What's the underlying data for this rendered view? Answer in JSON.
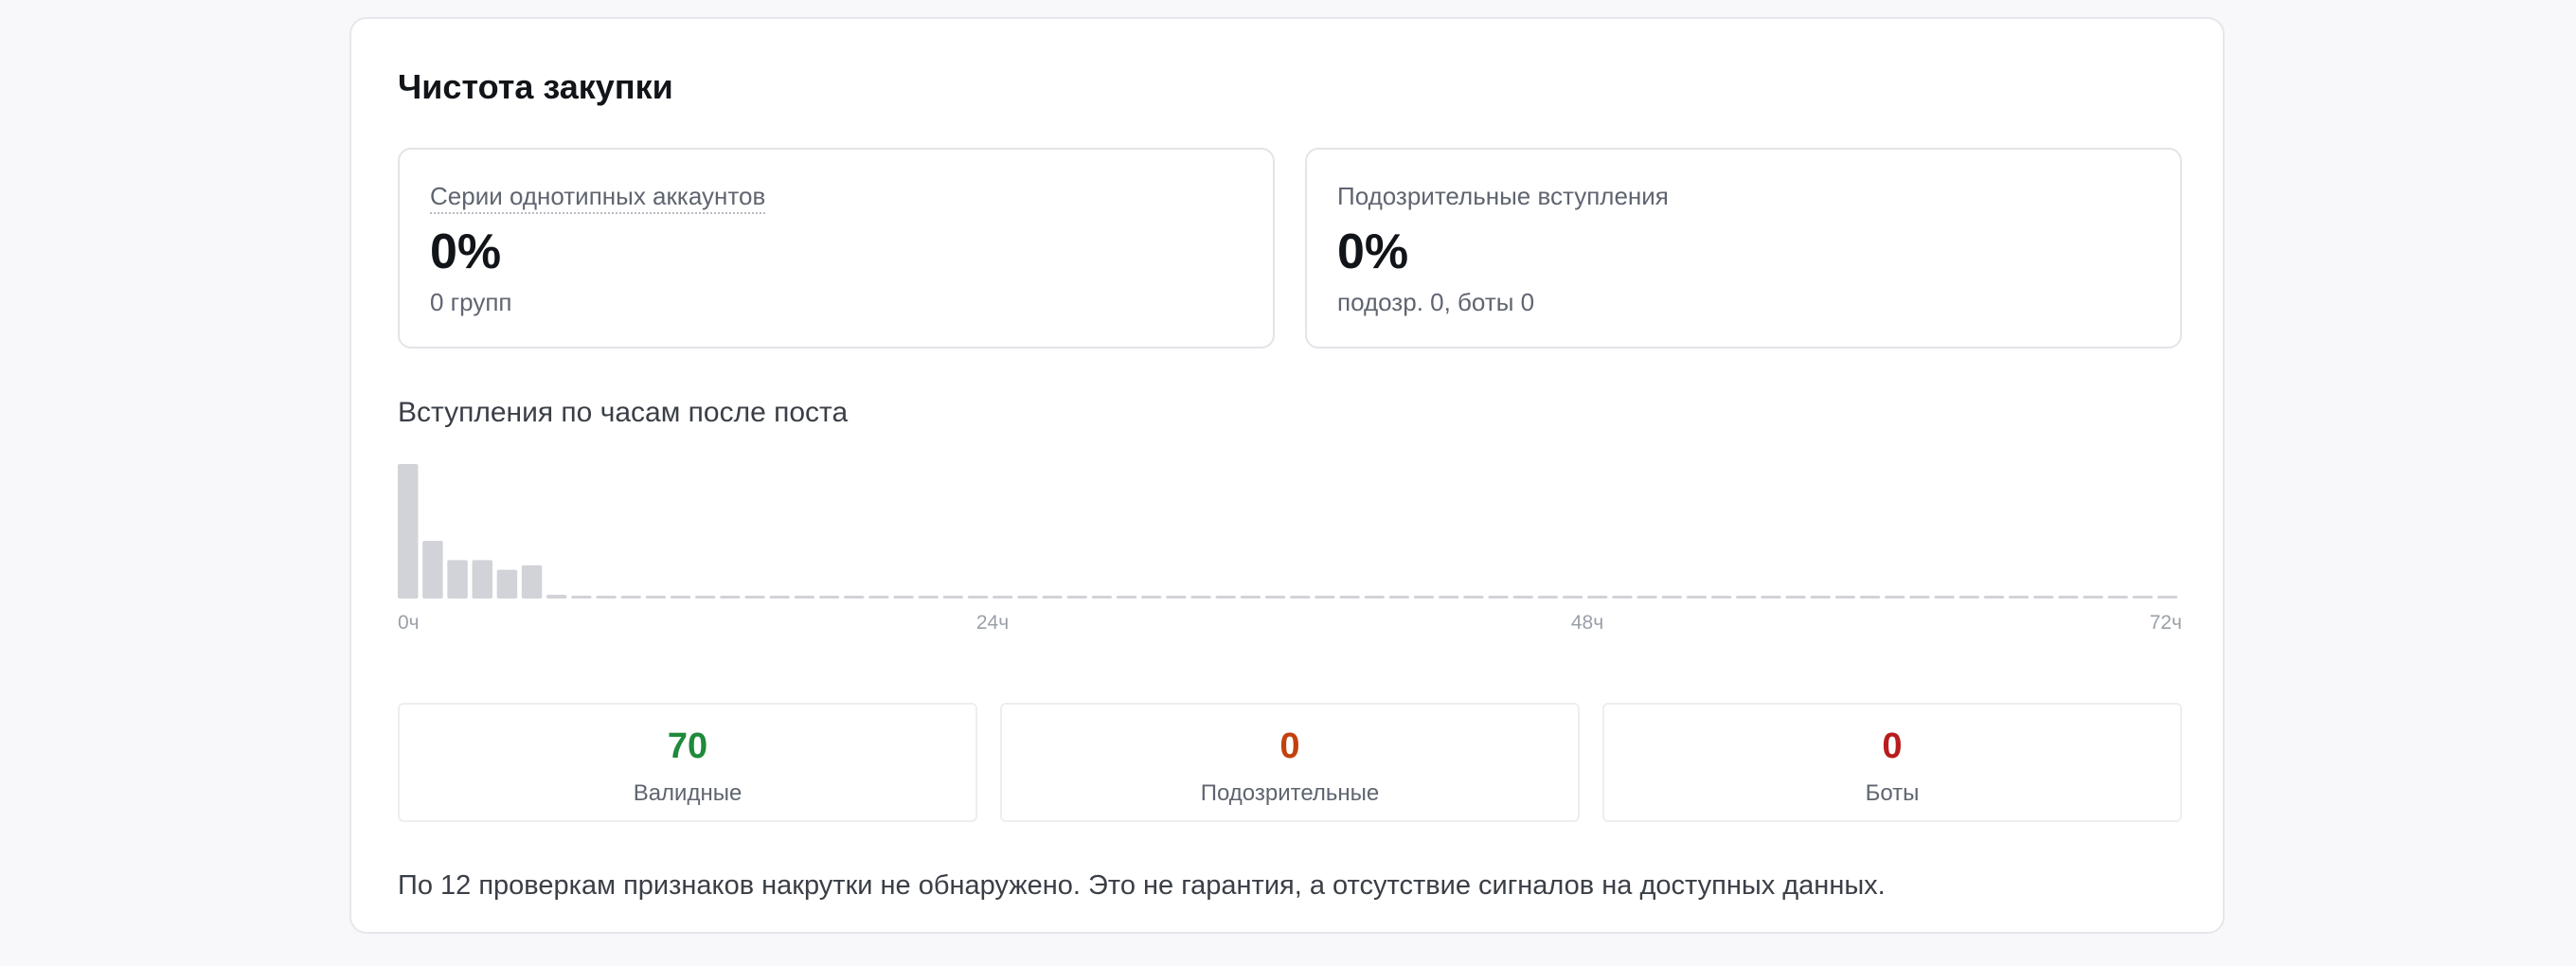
{
  "section": {
    "title": "Чистота закупки"
  },
  "metrics": [
    {
      "label": "Серии однотипных аккаунтов",
      "value": "0%",
      "sub": "0 групп"
    },
    {
      "label": "Подозрительные вступления",
      "value": "0%",
      "sub": "подозр. 0, боты 0"
    }
  ],
  "chart_data": {
    "type": "bar",
    "title": "Вступления по часам после поста",
    "x_tick_labels": [
      "0ч",
      "24ч",
      "48ч",
      "72ч"
    ],
    "hours": 72,
    "values": [
      21,
      9,
      6,
      6,
      4.5,
      5.2,
      0.6,
      0.05,
      0.05,
      0.05,
      0.05,
      0.05,
      0.05,
      0.05,
      0.05,
      0.05,
      0.05,
      0.05,
      0.05,
      0.05,
      0.05,
      0.05,
      0.05,
      0.05,
      0.05,
      0.05,
      0.05,
      0.05,
      0.05,
      0.05,
      0.05,
      0.05,
      0.05,
      0.05,
      0.05,
      0.05,
      0.05,
      0.05,
      0.05,
      0.05,
      0.05,
      0.05,
      0.05,
      0.05,
      0.05,
      0.05,
      0.05,
      0.05,
      0.05,
      0.05,
      0.05,
      0.05,
      0.05,
      0.05,
      0.05,
      0.05,
      0.05,
      0.05,
      0.05,
      0.05,
      0.05,
      0.05,
      0.05,
      0.05,
      0.05,
      0.05,
      0.05,
      0.05,
      0.05,
      0.05,
      0.05,
      0.05
    ],
    "bar_color": "#d1d3d8"
  },
  "stats": [
    {
      "value": "70",
      "label": "Валидные",
      "color": "#1f8a3b"
    },
    {
      "value": "0",
      "label": "Подозрительные",
      "color": "#c2410c"
    },
    {
      "value": "0",
      "label": "Боты",
      "color": "#b91c1c"
    }
  ],
  "note": "По 12 проверкам признаков накрутки не обнаружено. Это не гарантия, а отсутствие сигналов на доступных данных."
}
